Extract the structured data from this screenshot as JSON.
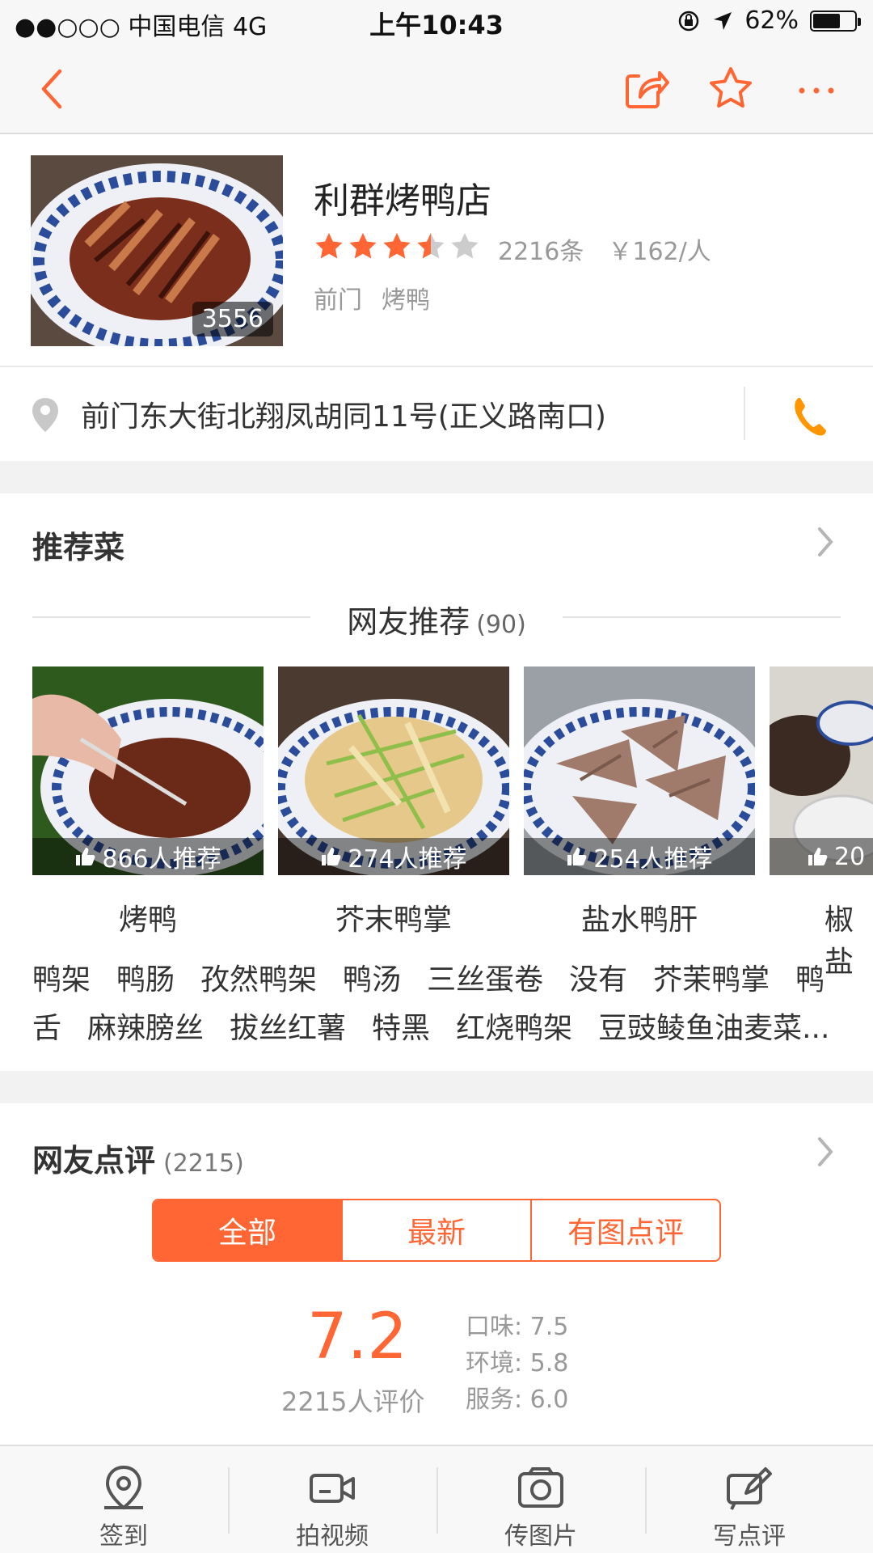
{
  "status_bar": {
    "carrier": "●●○○○ 中国电信   4G",
    "time": "上午10:43",
    "battery": "62%"
  },
  "nav": {
    "back_icon": "chevron-left-icon",
    "share_icon": "share-icon",
    "favorite_icon": "star-outline-icon",
    "more_icon": "more-icon"
  },
  "shop": {
    "name": "利群烤鸭店",
    "photo_count": "3556",
    "rating": 3.5,
    "reviews": "2216条",
    "price": "￥162/人",
    "tags": [
      "前门",
      "烤鸭"
    ],
    "address": "前门东大街北翔凤胡同11号(正义路南口)"
  },
  "recommended": {
    "title": "推荐菜",
    "subheading": "网友推荐",
    "subheading_count": "(90)",
    "dishes": [
      {
        "name": "烤鸭",
        "likes": "866人推荐"
      },
      {
        "name": "芥末鸭掌",
        "likes": "274人推荐"
      },
      {
        "name": "盐水鸭肝",
        "likes": "254人推荐"
      },
      {
        "name": "椒盐",
        "likes": "20"
      }
    ],
    "more_tags_row1": [
      "鸭架",
      "鸭肠",
      "孜然鸭架",
      "鸭汤",
      "三丝蛋卷",
      "没有",
      "芥茉鸭掌",
      "鸭"
    ],
    "more_tags_row2": [
      "舌",
      "麻辣膀丝",
      "拔丝红薯",
      "特黑",
      "红烧鸭架",
      "豆豉鲮鱼油麦菜..."
    ]
  },
  "reviews": {
    "title": "网友点评",
    "count": "(2215)",
    "filters": [
      "全部",
      "最新",
      "有图点评"
    ],
    "score": "7.2",
    "raters": "2215人评价",
    "sub_scores": [
      "口味: 7.5",
      "环境: 5.8",
      "服务: 6.0"
    ]
  },
  "tabbar": [
    {
      "label": "签到",
      "icon": "location-pin-icon"
    },
    {
      "label": "拍视频",
      "icon": "video-camera-icon"
    },
    {
      "label": "传图片",
      "icon": "photo-camera-icon"
    },
    {
      "label": "写点评",
      "icon": "edit-icon"
    }
  ],
  "colors": {
    "accent": "#ff6633",
    "star_filled": "#ff6633",
    "star_empty": "#cccccc"
  }
}
